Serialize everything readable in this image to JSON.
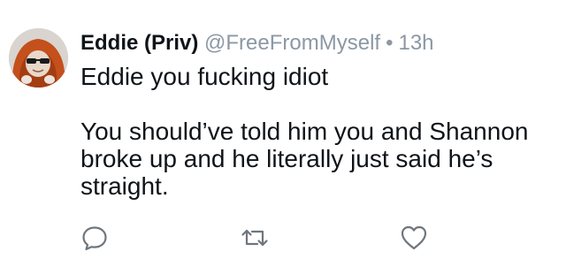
{
  "tweet": {
    "author_name": "Eddie (Priv)",
    "handle": "@FreeFromMyself",
    "separator": "•",
    "timestamp": "13h",
    "text_line1": "Eddie you fucking idiot",
    "text_para2": "You should’ve told him you and Shannon broke up and he literally just said he’s straight."
  },
  "actions": {
    "reply_icon": "speech-bubble-icon",
    "retweet_icon": "retweet-arrows-icon",
    "like_icon": "heart-outline-icon"
  },
  "colors": {
    "text": "#0f1419",
    "muted": "#8b98a5",
    "avatar_hoodie": "#c4501c",
    "icon": "#6e767d"
  }
}
